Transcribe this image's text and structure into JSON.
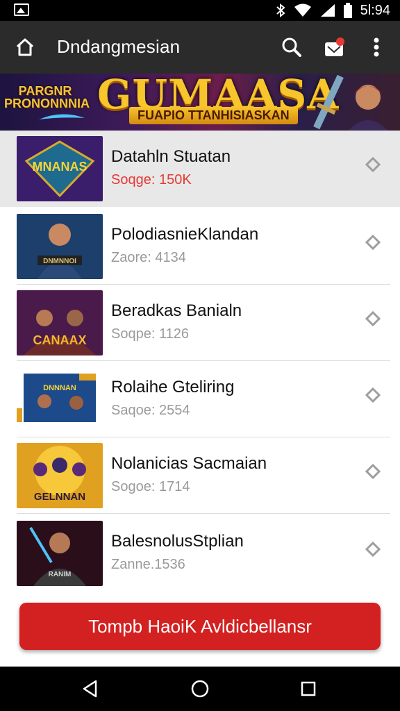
{
  "status_bar": {
    "time": "5l:94",
    "icons": [
      "gallery-icon",
      "bluetooth-icon",
      "wifi-icon",
      "signal-icon",
      "battery-icon"
    ]
  },
  "app_bar": {
    "title": "Dndangmesian",
    "icons": [
      "home-icon",
      "search-icon",
      "notification-icon",
      "more-icon"
    ]
  },
  "banner": {
    "left_text": "PARGNR PRONONNNIA",
    "title": "GUMAASA",
    "subtitle": "FUAPIO TTANHISIASKAN"
  },
  "items": [
    {
      "title": "Datahln Stuatan",
      "subtitle": "Soqge: 150K",
      "thumb_text": "MNANAS",
      "selected": true
    },
    {
      "title": "PolodiasnieKlandan",
      "subtitle": "Zaore: 4134",
      "thumb_text": "DNMNNOI",
      "selected": false
    },
    {
      "title": "Beradkas Banialn",
      "subtitle": "Soqpe: 1126",
      "thumb_text": "CANAAX",
      "selected": false
    },
    {
      "title": "Rolaihe Gteliring",
      "subtitle": "Saqoe: 2554",
      "thumb_text": "DNNNAN",
      "selected": false
    },
    {
      "title": "Nolanicias Sacmaian",
      "subtitle": "Sogoe: 1714",
      "thumb_text": "GELNNAN",
      "selected": false
    },
    {
      "title": "BalesnolusStplian",
      "subtitle": "Zanne.1536",
      "thumb_text": "RANIM",
      "selected": false
    }
  ],
  "cta": {
    "label": "Tompb HaoiK Avldicbellansr"
  },
  "colors": {
    "accent": "#d32020",
    "app_bar": "#2b2b2b",
    "selected_row": "#e8e8e8"
  }
}
